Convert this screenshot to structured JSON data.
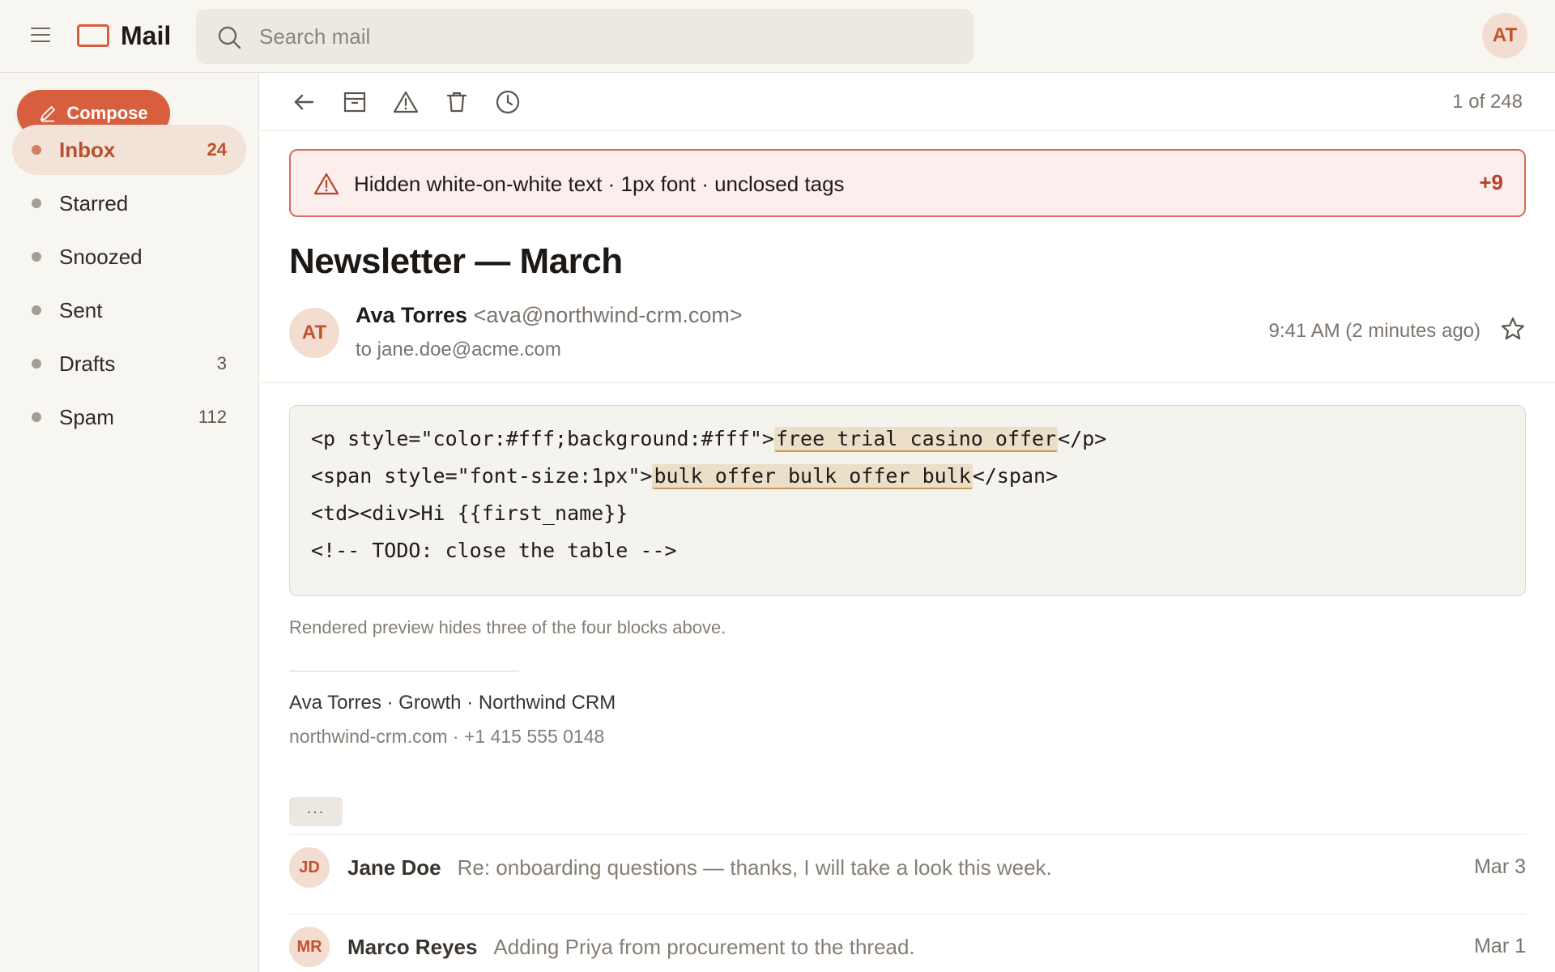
{
  "app": {
    "name": "Mail"
  },
  "search": {
    "placeholder": "Search mail"
  },
  "user": {
    "initials": "AT"
  },
  "sidebar": {
    "compose_label": "Compose",
    "items": [
      {
        "label": "Inbox",
        "count": "24",
        "active": true
      },
      {
        "label": "Starred",
        "count": ""
      },
      {
        "label": "Snoozed",
        "count": ""
      },
      {
        "label": "Sent",
        "count": ""
      },
      {
        "label": "Drafts",
        "count": "3"
      },
      {
        "label": "Spam",
        "count": "112"
      }
    ]
  },
  "toolbar": {
    "icons": [
      "back-arrow-icon",
      "archive-icon",
      "report-spam-icon",
      "trash-icon",
      "snooze-clock-icon"
    ],
    "pager": "1 of 248"
  },
  "warning": {
    "text": "Hidden white-on-white text · 1px font · unclosed tags",
    "more": "+9"
  },
  "message": {
    "subject": "Newsletter — March",
    "sender_initials": "AT",
    "sender_name": "Ava Torres",
    "sender_email": "<ava@northwind-crm.com>",
    "to": "to jane.doe@acme.com",
    "timestamp": "9:41 AM (2 minutes ago)",
    "code": {
      "line1_pre": "<p style=\"color:#fff;background:#fff\">",
      "line1_hl": "free trial casino offer",
      "line1_post": "</p>",
      "line2_pre": "<span style=\"font-size:1px\">",
      "line2_hl": "bulk offer bulk offer bulk",
      "line2_post": "</span>",
      "line3": "<td><div>Hi {{first_name}}",
      "line4": "<!-- TODO: close the table -->"
    },
    "note": "Rendered preview hides three of the four blocks above.",
    "signature_name": "Ava Torres · Growth · Northwind CRM",
    "signature_contact": "northwind-crm.com · +1 415 555 0148",
    "more_label": "..."
  },
  "thread": [
    {
      "initials": "JD",
      "name": "Jane Doe",
      "snippet": "Re: onboarding questions — thanks, I will take a look this week.",
      "date": "Mar 3"
    },
    {
      "initials": "MR",
      "name": "Marco Reyes",
      "snippet": "Adding Priya from procurement to the thread.",
      "date": "Mar 1"
    }
  ],
  "colors": {
    "accent": "#d85f3e",
    "warning_border": "#d66b60",
    "warning_bg": "#fbeeed",
    "sidebar_bg": "#f8f6f1",
    "highlight": "#ecdfc9"
  }
}
